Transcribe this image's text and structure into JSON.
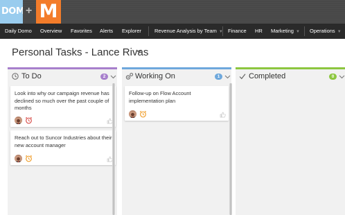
{
  "brand": {
    "domo_logo": "DOMO",
    "plus": "+",
    "m_logo": "M",
    "colors": {
      "domo": "#99ccee",
      "m": "#f37c2a"
    }
  },
  "nav": {
    "items": [
      {
        "label": "Daily Domo"
      },
      {
        "label": "Overview"
      },
      {
        "label": "Favorites"
      },
      {
        "label": "Alerts"
      },
      {
        "label": "Explorer"
      },
      {
        "label": "Revenue Analysis by Team",
        "dropdown": true
      },
      {
        "label": "Finance"
      },
      {
        "label": "HR"
      },
      {
        "label": "Marketing",
        "dropdown": true
      },
      {
        "label": "Operations",
        "dropdown": true
      }
    ]
  },
  "page": {
    "title": "Personal Tasks - Lance Rivas",
    "title_icon": "chevron-down-icon"
  },
  "columns": [
    {
      "title": "To Do",
      "icon": "clock-icon",
      "count": "2",
      "accent": "#a77fcc",
      "cards": [
        {
          "text": "Look into why our campaign revenue has declined so much over the past couple of months",
          "alarm_color": "#d9534f"
        },
        {
          "text": "Reach out to Suncor Industries about their new account manager",
          "alarm_color": "#f0a030"
        }
      ]
    },
    {
      "title": "Working On",
      "icon": "gears-icon",
      "count": "1",
      "accent": "#6ea8dc",
      "cards": [
        {
          "text": "Follow-up on Flow Account implementation plan",
          "alarm_color": "#f0a030"
        }
      ]
    },
    {
      "title": "Completed",
      "icon": "checkmark-icon",
      "count": "0",
      "accent": "#8cc63f",
      "cards": []
    }
  ]
}
